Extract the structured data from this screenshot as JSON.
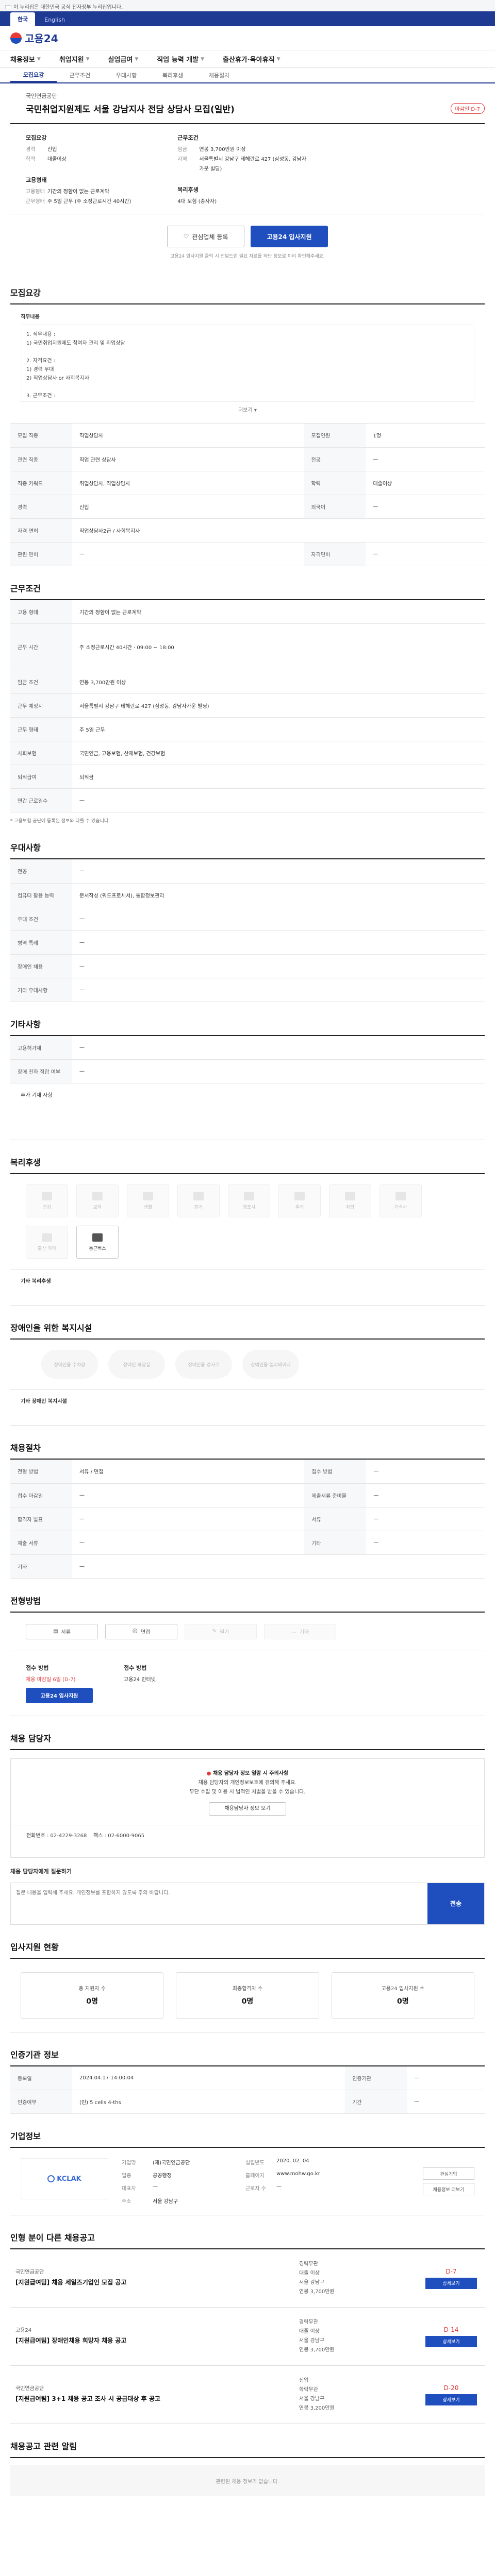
{
  "gov_banner": "이 누리집은 대한민국 공식 전자정부 누리집입니다.",
  "lang": [
    "한국",
    "English"
  ],
  "site_name": "고용24",
  "gnb": [
    "채용정보",
    "취업지원",
    "실업급여",
    "직업 능력 개발",
    "출산휴가·육아휴직"
  ],
  "tabs": [
    "모집요강",
    "근무조건",
    "우대사항",
    "복리후생",
    "채용절차"
  ],
  "job": {
    "org": "국민연금공단",
    "title": "국민취업지원제도 서울 강남지사 전담 상담사 모집(일반)",
    "dday": "마감일 D-7",
    "recruit_h": "모집요강",
    "recruit": [
      [
        "경력",
        "신입"
      ],
      [
        "학력",
        "대졸이상"
      ]
    ],
    "work_h": "근무조건",
    "work": [
      [
        "임금",
        "연봉 3,700만원 이상"
      ],
      [
        "지역",
        "서울특별시 강남구 테헤란로 427 (삼성동, 강남자가운 빌딩)"
      ]
    ],
    "type_h": "고용형태",
    "type": [
      [
        "고용형태",
        "기간의 정함이 없는 근로계약"
      ],
      [
        "근무형태",
        "주 5일 근무 (주 소정근로시간 40시간)"
      ]
    ],
    "benefit_h": "복리후생",
    "benefit": [
      [
        "",
        "4대 보험 (종사자)"
      ]
    ],
    "btn_scrap": "관심업체 등록",
    "btn_apply": "고용24 입사지원",
    "notice": "고용24 입사지원 클릭 시 전달드린 필요 자료를 하단 정보로 미리 확인해주세요."
  },
  "s1": {
    "title": "모집요강",
    "body_h": "직무내용",
    "body": "1. 직무내용 :\n  1) 국민취업지원제도 참여자 관리 및 취업상담\n\n2. 자격요건 :\n  1) 경력 우대\n  2) 직업상담사 or 사회복지사\n\n3. 근무조건 :\n  1) 근무지 : 서울시 강남구",
    "more": "더보기 ▾",
    "rows": [
      [
        "모집 직종",
        "직업상담사"
      ],
      [
        "관련 직종",
        "직업 관련 상담사"
      ],
      [
        "직종 키워드",
        "취업상담사, 직업상담사"
      ],
      [
        "경력",
        "신입"
      ],
      [
        "자격 면허",
        "직업상담사2급 / 사회복지사"
      ],
      [
        "관련 면허",
        "—"
      ]
    ],
    "side": [
      [
        "모집인원",
        "1명"
      ],
      [
        "전공",
        "—"
      ],
      [
        "학력",
        "대졸이상"
      ],
      [
        "외국어",
        "—"
      ],
      [
        "자격면허",
        "—"
      ]
    ]
  },
  "s2": {
    "title": "근무조건",
    "rows": [
      [
        "고용 형태",
        "기간의 정함이 없는 근로계약"
      ],
      [
        "근무 시간",
        "주 소정근로시간 40시간 · 09:00 ~ 18:00"
      ],
      [
        "임금 조건",
        "연봉 3,700만원 이상"
      ],
      [
        "근무 예정지",
        "서울특별시 강남구 테헤란로 427 (삼성동, 강남자가운 빌딩)"
      ],
      [
        "근무 형태",
        "주 5일 근무"
      ],
      [
        "사회보험",
        "국민연금, 고용보험, 산재보험, 건강보험"
      ],
      [
        "퇴직급여",
        "퇴직금"
      ],
      [
        "연간 근로일수",
        "—"
      ]
    ],
    "notes": "* 고용보험 공단에 등록된 정보와 다를 수 있습니다."
  },
  "s3": {
    "title": "우대사항",
    "rows": [
      [
        "전공",
        "—"
      ],
      [
        "컴퓨터 활용 능력",
        "문서작성 (워드프로세서), 통합정보관리"
      ],
      [
        "우대 조건",
        "—"
      ],
      [
        "병역 특례",
        "—"
      ],
      [
        "장애인 채용",
        "—"
      ],
      [
        "기타 우대사항",
        "—"
      ]
    ]
  },
  "s4": {
    "title": "기타사항",
    "rows": [
      [
        "고용허가제",
        "—"
      ],
      [
        "장애 친화 적합 여부",
        "—"
      ]
    ],
    "free": "추가 기재 사항"
  },
  "s5": {
    "title": "복리후생",
    "icons": [
      "건강",
      "교육",
      "생활",
      "휴가",
      "경조사",
      "주거",
      "차량",
      "기숙사",
      "출산 육아",
      "통근버스"
    ],
    "sub": "기타 복리후생"
  },
  "s6": {
    "title": "장애인을 위한 복지시설",
    "icons": [
      "장애인용 주차장",
      "장애인 화장실",
      "장애인용 경사로",
      "장애인용 엘리베이터"
    ],
    "sub": "기타 장애인 복지시설"
  },
  "s7": {
    "title": "채용절차",
    "rows": [
      [
        "전형 방법",
        "서류 / 면접"
      ],
      [
        "접수 마감일",
        "—"
      ],
      [
        "합격자 발표",
        "—"
      ],
      [
        "제출 서류",
        "—"
      ],
      [
        "기타",
        "—"
      ]
    ],
    "side": [
      [
        "접수 방법",
        "—"
      ],
      [
        "제출서류 준비물",
        "—"
      ],
      [
        "서류",
        "—"
      ],
      [
        "기타",
        "—"
      ]
    ]
  },
  "s8": {
    "title": "전형방법",
    "pills": [
      "서류",
      "면접",
      "필기",
      "기타"
    ]
  },
  "s9": {
    "h1": "접수 방법",
    "apply": "채용 마감일 6일 (D-7)",
    "apply_btn": "고용24 입사지원",
    "h2": "접수 방법",
    "how": "고용24 인터넷"
  },
  "s10": {
    "title": "채용 담당자",
    "warn": "채용 담당자 정보 열람 시 주의사항",
    "p1": "채용 담당자의 개인정보보호에 유의해 주세요.",
    "p2": "무단 수집 및 이용 시 법적인 처벌을 받을 수 있습니다.",
    "btn": "채용담당자 정보 보기",
    "tel": "전화번호 : 02-4229-3268",
    "fax": "팩스 : 02-6000-9065"
  },
  "s11": {
    "title": "채용 담당자에게 질문하기",
    "placeholder": "질문 내용을 입력해 주세요. 개인정보를 포함하지 않도록 주의 바랍니다.",
    "btn": "전송"
  },
  "s12": {
    "title": "입사지원 현황",
    "items": [
      [
        "총 지원자 수",
        "0명"
      ],
      [
        "최종합격자 수",
        "0명"
      ],
      [
        "고용24 입사지원 수",
        "0명"
      ]
    ]
  },
  "s13": {
    "title": "인증기관 정보",
    "rows": [
      [
        "등록일",
        "2024.04.17 14:00:04"
      ],
      [
        "인증기관",
        "—"
      ],
      [
        "인증여부",
        "(인) 5 cells 4-ths"
      ],
      [
        "기간",
        "—"
      ]
    ]
  },
  "s14": {
    "title": "기업정보",
    "logo": "KCLAK",
    "rows": [
      [
        "기업명",
        "(재)국민연금공단"
      ],
      [
        "업종",
        "공공행정"
      ],
      [
        "대표자",
        "—"
      ],
      [
        "주소",
        "서울 강남구"
      ],
      [
        "설립년도",
        "2020. 02. 04"
      ],
      [
        "홈페이지",
        "www.mohw.go.kr"
      ],
      [
        "근로자 수",
        "—"
      ]
    ],
    "btns": [
      "관심기업",
      "채용정보 더보기"
    ]
  },
  "s15": {
    "title": "인형 분이 다른 채용공고",
    "items": [
      {
        "org": "국민연금공단",
        "title": "[지원급여팀] 채용 세일즈기업인 모집 공고",
        "info": [
          "경력무관",
          "대졸 이상",
          "서울 강남구",
          "연봉 3,700만원"
        ],
        "d": "D-7"
      },
      {
        "org": "고용24",
        "title": "[지원급여팀] 장애인채용 희망자 채용 공고",
        "info": [
          "경력무관",
          "대졸 이상",
          "서울 강남구",
          "연봉 3,700만원"
        ],
        "d": "D-14"
      },
      {
        "org": "국민연금공단",
        "title": "[지원급여팀] 3+1 채용 공고 조사 시 공급대상 후 공고",
        "info": [
          "신입",
          "학력무관",
          "서울 강남구",
          "연봉 3,200만원"
        ],
        "d": "D-20"
      }
    ],
    "btn": "상세보기"
  },
  "s16": {
    "title": "채용공고 관련 알림",
    "empty": "관련된 채용 정보가 없습니다."
  }
}
